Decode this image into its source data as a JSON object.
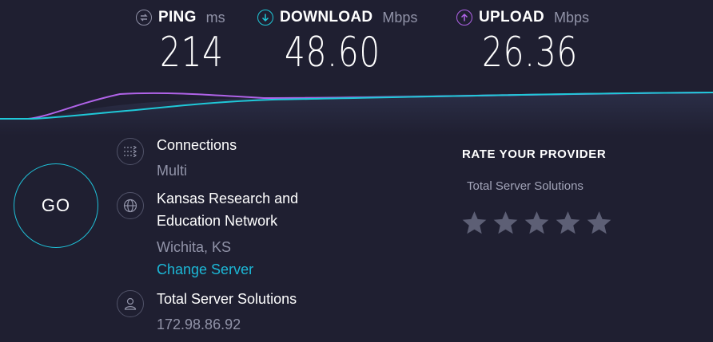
{
  "metrics": {
    "ping": {
      "label": "PING",
      "unit": "ms",
      "value": "214",
      "color": "#8f90a6",
      "icon": "ping-icon"
    },
    "download": {
      "label": "DOWNLOAD",
      "unit": "Mbps",
      "value": "48.60",
      "color": "#1fc8d8",
      "icon": "download-arrow-icon"
    },
    "upload": {
      "label": "UPLOAD",
      "unit": "Mbps",
      "value": "26.36",
      "color": "#b063e8",
      "icon": "upload-arrow-icon"
    }
  },
  "go_button": {
    "label": "GO"
  },
  "connections": {
    "title": "Connections",
    "value": "Multi",
    "icon": "connections-icon"
  },
  "server": {
    "name_line1": "Kansas Research and",
    "name_line2": "Education Network",
    "location": "Wichita, KS",
    "change_link": "Change Server",
    "icon": "globe-icon"
  },
  "provider": {
    "name": "Total Server Solutions",
    "ip": "172.98.86.92",
    "icon": "user-icon"
  },
  "rate": {
    "title": "RATE YOUR PROVIDER",
    "provider": "Total Server Solutions",
    "max_stars": 5,
    "selected_stars": 0
  },
  "colors": {
    "background": "#1f1f31",
    "accent": "#1cb8d7",
    "star": "#5d5f75"
  }
}
